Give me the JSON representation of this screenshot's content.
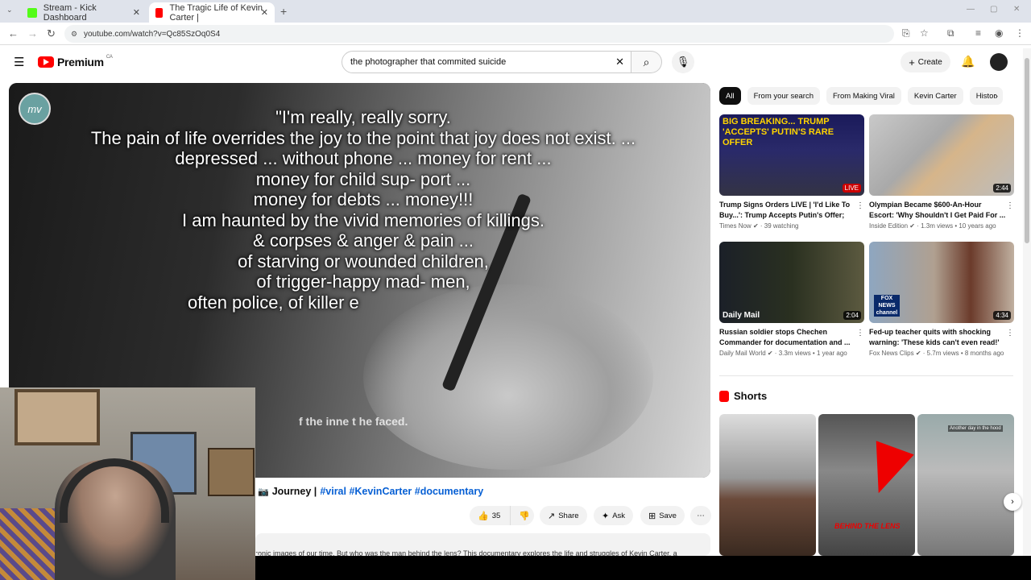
{
  "browser": {
    "tabs": [
      {
        "title": "Stream - Kick Dashboard",
        "favicon_color": "#53fc18"
      },
      {
        "title": "The Tragic Life of Kevin Carter |",
        "favicon_color": "#ff0000"
      }
    ],
    "url": "youtube.com/watch?v=Qc85SzOq0S4"
  },
  "header": {
    "brand": "Premium",
    "region": "CA",
    "search_query": "the photographer that commited suicide",
    "create_label": "Create"
  },
  "video": {
    "channel_mark": "mv",
    "quote_lines": [
      "\"I'm really, really sorry.",
      "The pain of life overrides the joy to the point that joy does not exist. ...",
      "depressed ... without phone ... money for rent ...",
      "money for child sup- port ...",
      "money for debts ... money!!!",
      "I am haunted by the vivid memories of killings.",
      "& corpses & anger & pain ...",
      "of starving or wounded children,",
      "of trigger-happy mad- men,",
      "often police, of killer e"
    ],
    "subtitle": "f the inne      t he faced.",
    "title_prefix": "Journey |",
    "title_tags": "#viral #KevinCarter #documentary",
    "likes": "35",
    "share_label": "Share",
    "ask_label": "Ask",
    "save_label": "Save",
    "description": "ronic images of our time. But who was the man behind the lens? This documentary explores the life and struggles of Kevin Carter, a"
  },
  "chips": [
    "All",
    "From your search",
    "From Making Viral",
    "Kevin Carter",
    "Histor"
  ],
  "recommendations": [
    {
      "title": "Trump Signs Orders LIVE | 'I'd Like To Buy...': Trump Accepts Putin's Offer; U...",
      "channel": "Times Now",
      "meta": "39 watching",
      "badge": "LIVE",
      "thumb_text": "BIG BREAKING... TRUMP 'ACCEPTS' PUTIN'S RARE OFFER"
    },
    {
      "title": "Olympian Became $600-An-Hour Escort: 'Why Shouldn't I Get Paid For ...",
      "channel": "Inside Edition",
      "meta": "1.3m views • 10 years ago",
      "badge": "2:44",
      "thumb_text": ""
    },
    {
      "title": "Russian soldier stops Chechen Commander for documentation and ...",
      "channel": "Daily Mail World",
      "meta": "3.3m views • 1 year ago",
      "badge": "2:04",
      "thumb_text": "Daily Mail"
    },
    {
      "title": "Fed-up teacher quits with shocking warning: 'These kids can't even read!'",
      "channel": "Fox News Clips",
      "meta": "5.7m views • 8 months ago",
      "badge": "4:34",
      "thumb_text": "FOX NEWS channel"
    }
  ],
  "shorts": {
    "heading": "Shorts",
    "items": [
      {
        "caption": ""
      },
      {
        "caption": "BEHIND THE LENS"
      },
      {
        "caption": "Another day in the hood"
      }
    ]
  }
}
